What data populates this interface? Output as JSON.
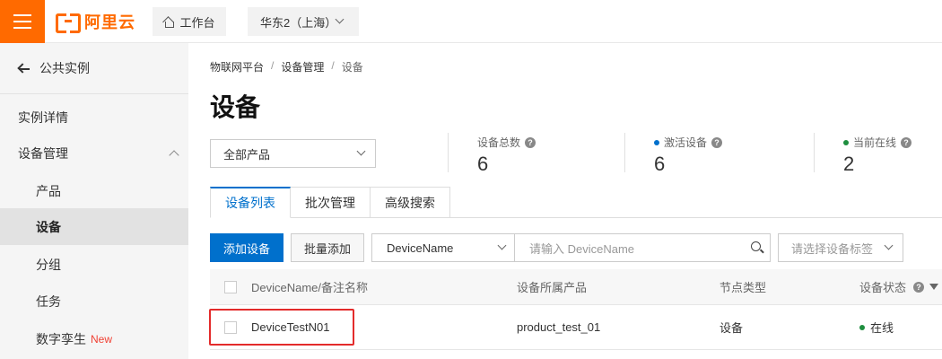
{
  "header": {
    "logo_text": "阿里云",
    "workbench_label": "工作台",
    "region_label": "华东2（上海）"
  },
  "sidebar": {
    "back_label": "公共实例",
    "items": [
      {
        "label": "实例详情"
      },
      {
        "label": "设备管理"
      },
      {
        "label": "产品"
      },
      {
        "label": "设备"
      },
      {
        "label": "分组"
      },
      {
        "label": "任务"
      },
      {
        "label": "数字孪生",
        "badge": "New"
      }
    ]
  },
  "breadcrumb": [
    "物联网平台",
    "设备管理",
    "设备"
  ],
  "breadcrumb_sep": "/",
  "page_title": "设备",
  "product_filter": {
    "value": "全部产品"
  },
  "stats": [
    {
      "label": "设备总数",
      "value": "6"
    },
    {
      "label": "激活设备",
      "value": "6",
      "dot_color": "#0070cc"
    },
    {
      "label": "当前在线",
      "value": "2",
      "dot_color": "#1e8e3e"
    }
  ],
  "tabs": [
    "设备列表",
    "批次管理",
    "高级搜索"
  ],
  "toolbar": {
    "add_label": "添加设备",
    "batch_add_label": "批量添加",
    "field_select_value": "DeviceName",
    "search_placeholder": "请输入 DeviceName",
    "tag_placeholder": "请选择设备标签"
  },
  "table": {
    "columns": [
      "DeviceName/备注名称",
      "设备所属产品",
      "节点类型",
      "设备状态"
    ],
    "rows": [
      {
        "name": "DeviceTestN01",
        "product": "product_test_01",
        "node_type": "设备",
        "status": "在线",
        "status_color": "#1e8e3e"
      }
    ]
  },
  "colors": {
    "brand": "#ff6a00",
    "primary": "#0070cc",
    "highlight": "#e32b2b"
  }
}
